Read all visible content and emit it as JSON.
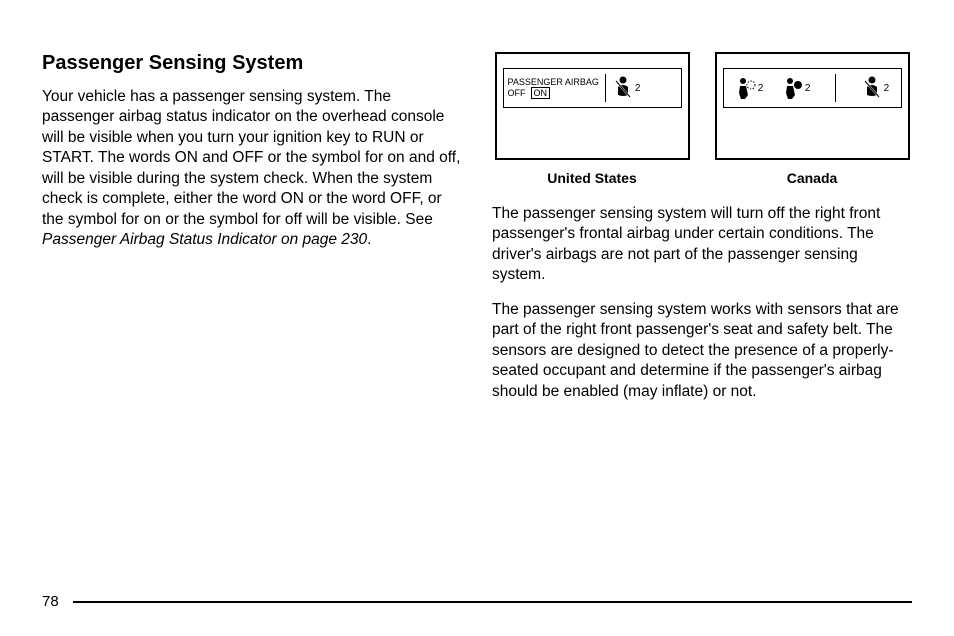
{
  "heading": "Passenger Sensing System",
  "left_para": "Your vehicle has a passenger sensing system. The passenger airbag status indicator on the overhead console will be visible when you turn your ignition key to RUN or START. The words ON and OFF or the symbol for on and off, will be visible during the system check. When the system check is complete, either the word ON or the word OFF, or the symbol for on or the symbol for off will be visible. See ",
  "ref_text": "Passenger Airbag Status Indicator on page 230",
  "ref_end": ".",
  "us_label1": "PASSENGER AIRBAG",
  "us_label2": "OFF",
  "us_on": "ON",
  "icon_sub": "2",
  "caption_us": "United States",
  "caption_ca": "Canada",
  "right_para1": "The passenger sensing system will turn off the right front passenger's frontal airbag under certain conditions. The driver's airbags are not part of the passenger sensing system.",
  "right_para2": "The passenger sensing system works with sensors that are part of the right front passenger's seat and safety belt. The sensors are designed to detect the presence of a properly-seated occupant and determine if the passenger's airbag should be enabled (may inflate) or not.",
  "page_number": "78"
}
